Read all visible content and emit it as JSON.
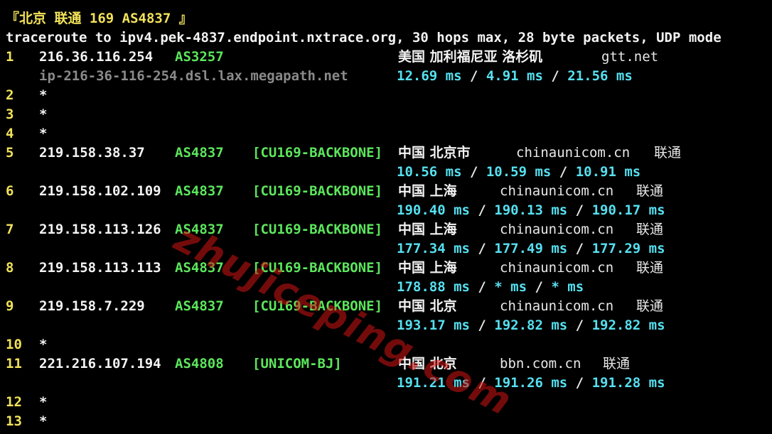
{
  "title": "『北京 联通 169 AS4837 』",
  "command": "traceroute to ipv4.pek-4837.endpoint.nxtrace.org, 30 hops max, 28 byte packets, UDP mode",
  "hops": [
    {
      "num": "1",
      "ip": "216.36.116.254",
      "asn": "AS3257",
      "tag": "",
      "geo": "美国 加利福尼亚 洛杉矶",
      "org": "gtt.net",
      "isp": "",
      "host": "ip-216-36-116-254.dsl.lax.megapath.net",
      "rtt": [
        "12.69 ms",
        "4.91 ms",
        "21.56 ms"
      ]
    },
    {
      "num": "2",
      "ip": "*"
    },
    {
      "num": "3",
      "ip": "*"
    },
    {
      "num": "4",
      "ip": "*"
    },
    {
      "num": "5",
      "ip": "219.158.38.37",
      "asn": "AS4837",
      "tag": "[CU169-BACKBONE]",
      "geo": "中国 北京市",
      "org": "chinaunicom.cn",
      "isp": "联通",
      "rtt": [
        "10.56 ms",
        "10.59 ms",
        "10.91 ms"
      ]
    },
    {
      "num": "6",
      "ip": "219.158.102.109",
      "asn": "AS4837",
      "tag": "[CU169-BACKBONE]",
      "geo": "中国 上海",
      "org": "chinaunicom.cn",
      "isp": "联通",
      "rtt": [
        "190.40 ms",
        "190.13 ms",
        "190.17 ms"
      ]
    },
    {
      "num": "7",
      "ip": "219.158.113.126",
      "asn": "AS4837",
      "tag": "[CU169-BACKBONE]",
      "geo": "中国 上海",
      "org": "chinaunicom.cn",
      "isp": "联通",
      "rtt": [
        "177.34 ms",
        "177.49 ms",
        "177.29 ms"
      ]
    },
    {
      "num": "8",
      "ip": "219.158.113.113",
      "asn": "AS4837",
      "tag": "[CU169-BACKBONE]",
      "geo": "中国 上海",
      "org": "chinaunicom.cn",
      "isp": "联通",
      "rtt": [
        "178.88 ms",
        "* ms",
        "* ms"
      ]
    },
    {
      "num": "9",
      "ip": "219.158.7.229",
      "asn": "AS4837",
      "tag": "[CU169-BACKBONE]",
      "geo": "中国 北京",
      "org": "chinaunicom.cn",
      "isp": "联通",
      "rtt": [
        "193.17 ms",
        "192.82 ms",
        "192.82 ms"
      ]
    },
    {
      "num": "10",
      "ip": "*"
    },
    {
      "num": "11",
      "ip": "221.216.107.194",
      "asn": "AS4808",
      "tag": "[UNICOM-BJ]",
      "geo": "中国 北京",
      "org": "bbn.com.cn",
      "isp": "联通",
      "rtt": [
        "191.21 ms",
        "191.26 ms",
        "191.28 ms"
      ]
    },
    {
      "num": "12",
      "ip": "*"
    },
    {
      "num": "13",
      "ip": "*"
    }
  ],
  "rtt_separator": "/",
  "watermark": "zhujiceping.com"
}
